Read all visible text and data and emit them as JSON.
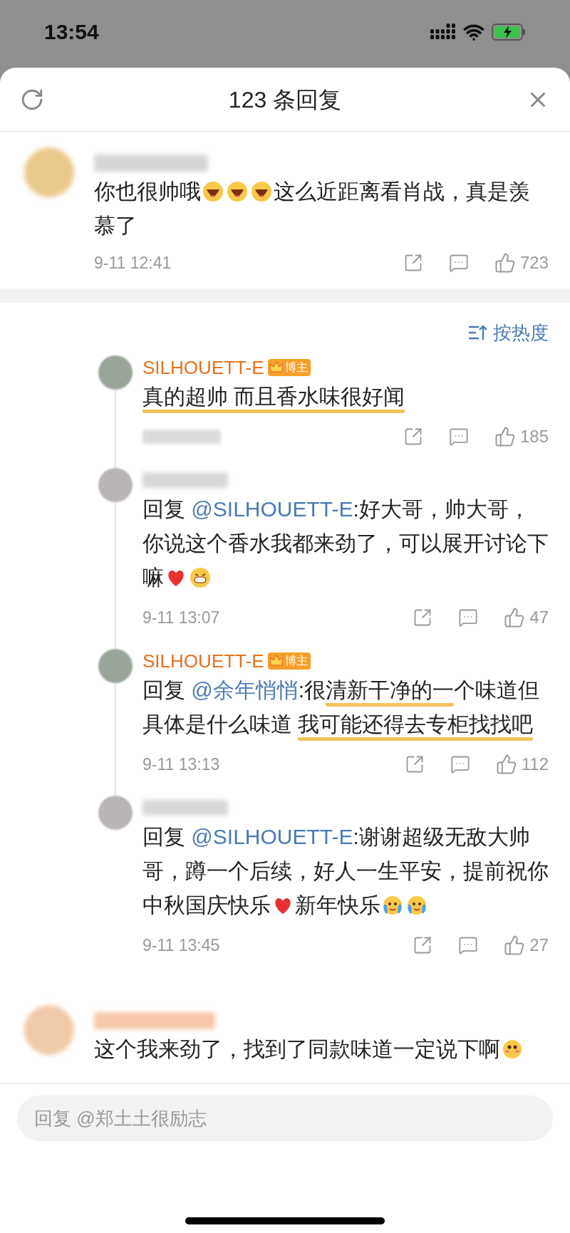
{
  "status_bar": {
    "time": "13:54"
  },
  "header": {
    "title": "123 条回复"
  },
  "comment": {
    "body": [
      {
        "kind": "text",
        "text": "你也很帅哦"
      },
      {
        "kind": "laugh"
      },
      {
        "kind": "laugh"
      },
      {
        "kind": "laugh"
      },
      {
        "kind": "text",
        "text": "这么近距离看肖战，真是羡慕了"
      }
    ],
    "time": "9-11 12:41",
    "likes": "723"
  },
  "sort": {
    "label": "按热度"
  },
  "replies": [
    {
      "author": "SILHOUETT-E",
      "badge": "博主",
      "body": [
        {
          "kind": "text",
          "text": "真的超帅 而且香水味很好闻",
          "underlined": true
        }
      ],
      "time_hidden": true,
      "likes": "185"
    },
    {
      "body": [
        {
          "kind": "text",
          "text": "回复 "
        },
        {
          "kind": "mention",
          "text": "@SILHOUETT-E"
        },
        {
          "kind": "text",
          "text": ":好大哥，帅大哥，你说这个香水我都来劲了，可以展开讨论下嘛"
        },
        {
          "kind": "heart"
        },
        {
          "kind": "grin"
        }
      ],
      "time_hidden": false,
      "time": "9-11 13:07",
      "likes": "47"
    },
    {
      "author": "SILHOUETT-E",
      "badge": "博主",
      "body": [
        {
          "kind": "text",
          "text": "回复 "
        },
        {
          "kind": "mention",
          "text": "@余年悄悄"
        },
        {
          "kind": "text",
          "text": ":很",
          "underlined": false
        },
        {
          "kind": "text",
          "text": "清新干净的一",
          "underlined": true
        },
        {
          "kind": "text",
          "text": "个味道但具体是什么味道 ",
          "underlined": false
        },
        {
          "kind": "text",
          "text": "我可能还得去专柜找找吧",
          "underlined": true
        }
      ],
      "time_hidden": false,
      "time": "9-11 13:13",
      "likes": "112"
    },
    {
      "body": [
        {
          "kind": "text",
          "text": "回复 "
        },
        {
          "kind": "mention",
          "text": "@SILHOUETT-E"
        },
        {
          "kind": "text",
          "text": ":谢谢超级无敌大帅哥，蹲一个后续，好人一生平安，提前祝你中秋国庆快乐"
        },
        {
          "kind": "heart"
        },
        {
          "kind": "text",
          "text": "新年快乐"
        },
        {
          "kind": "cry"
        },
        {
          "kind": "cry"
        }
      ],
      "time_hidden": false,
      "time": "9-11 13:45",
      "likes": "27"
    }
  ],
  "next_comment": {
    "body": [
      {
        "kind": "text",
        "text": "这个我来劲了，找到了同款味道一定说下啊"
      },
      {
        "kind": "blush"
      }
    ]
  },
  "reply_box": {
    "placeholder": "回复 @郑土土很励志"
  }
}
